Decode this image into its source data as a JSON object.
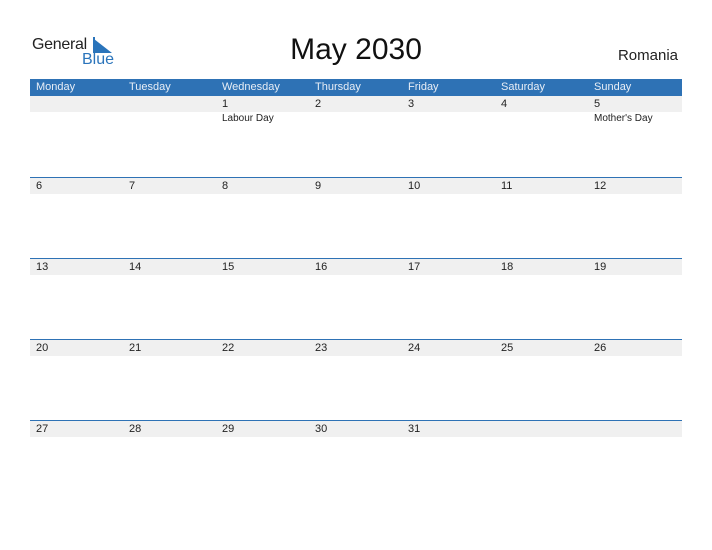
{
  "brand": {
    "general": "General",
    "blue": "Blue",
    "accent": "#2e72b5"
  },
  "title": "May 2030",
  "country": "Romania",
  "weekdays": [
    "Monday",
    "Tuesday",
    "Wednesday",
    "Thursday",
    "Friday",
    "Saturday",
    "Sunday"
  ],
  "weeks": [
    {
      "days": [
        "",
        "",
        "1",
        "2",
        "3",
        "4",
        "5"
      ],
      "holidays": [
        "",
        "",
        "Labour Day",
        "",
        "",
        "",
        "Mother's Day"
      ]
    },
    {
      "days": [
        "6",
        "7",
        "8",
        "9",
        "10",
        "11",
        "12"
      ],
      "holidays": [
        "",
        "",
        "",
        "",
        "",
        "",
        ""
      ]
    },
    {
      "days": [
        "13",
        "14",
        "15",
        "16",
        "17",
        "18",
        "19"
      ],
      "holidays": [
        "",
        "",
        "",
        "",
        "",
        "",
        ""
      ]
    },
    {
      "days": [
        "20",
        "21",
        "22",
        "23",
        "24",
        "25",
        "26"
      ],
      "holidays": [
        "",
        "",
        "",
        "",
        "",
        "",
        ""
      ]
    },
    {
      "days": [
        "27",
        "28",
        "29",
        "30",
        "31",
        "",
        ""
      ],
      "holidays": [
        "",
        "",
        "",
        "",
        "",
        "",
        ""
      ]
    }
  ]
}
